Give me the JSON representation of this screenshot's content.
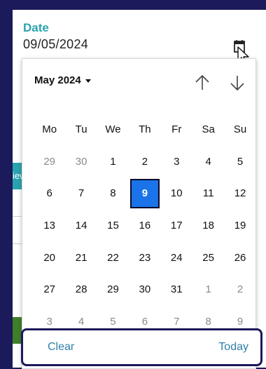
{
  "field": {
    "label": "Date",
    "value": "09/05/2024",
    "icon": "calendar-icon"
  },
  "background": {
    "tab_fragment": "iew"
  },
  "calendar": {
    "month_label": "May 2024",
    "weekdays": [
      "Mo",
      "Tu",
      "We",
      "Th",
      "Fr",
      "Sa",
      "Su"
    ],
    "weeks": [
      [
        "29",
        "30",
        "1",
        "2",
        "3",
        "4",
        "5"
      ],
      [
        "6",
        "7",
        "8",
        "9",
        "10",
        "11",
        "12"
      ],
      [
        "13",
        "14",
        "15",
        "16",
        "17",
        "18",
        "19"
      ],
      [
        "20",
        "21",
        "22",
        "23",
        "24",
        "25",
        "26"
      ],
      [
        "27",
        "28",
        "29",
        "30",
        "31",
        "1",
        "2"
      ],
      [
        "3",
        "4",
        "5",
        "6",
        "7",
        "8",
        "9"
      ]
    ],
    "selected_day": "9",
    "accent_color": "#1a73e8",
    "clear_label": "Clear",
    "today_label": "Today"
  }
}
